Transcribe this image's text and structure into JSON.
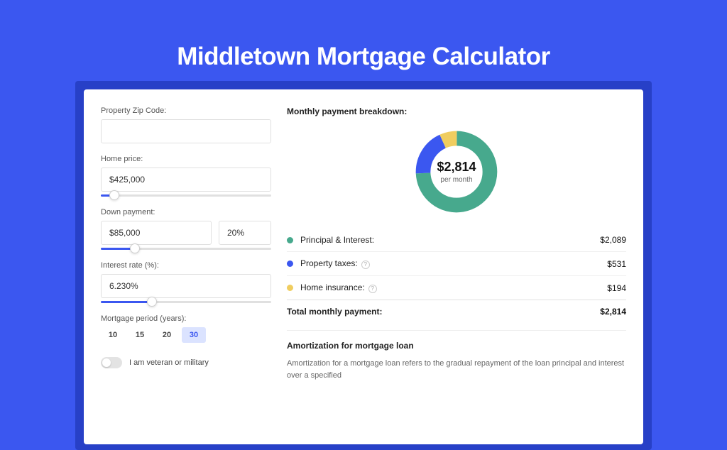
{
  "title": "Middletown Mortgage Calculator",
  "form": {
    "zip_label": "Property Zip Code:",
    "zip_value": "",
    "price_label": "Home price:",
    "price_value": "$425,000",
    "price_slider_pct": 8,
    "down_label": "Down payment:",
    "down_value": "$85,000",
    "down_pct_value": "20%",
    "down_slider_pct": 20,
    "rate_label": "Interest rate (%):",
    "rate_value": "6.230%",
    "rate_slider_pct": 30,
    "period_label": "Mortgage period (years):",
    "period_options": [
      {
        "label": "10",
        "active": false
      },
      {
        "label": "15",
        "active": false
      },
      {
        "label": "20",
        "active": false
      },
      {
        "label": "30",
        "active": true
      }
    ],
    "veteran_label": "I am veteran or military"
  },
  "breakdown": {
    "heading": "Monthly payment breakdown:",
    "center_amount": "$2,814",
    "center_sub": "per month",
    "items": [
      {
        "label": "Principal & Interest:",
        "value": "$2,089",
        "color": "#47a98d",
        "has_info": false
      },
      {
        "label": "Property taxes:",
        "value": "$531",
        "color": "#3b57f0",
        "has_info": true
      },
      {
        "label": "Home insurance:",
        "value": "$194",
        "color": "#f0cd5f",
        "has_info": true
      }
    ],
    "total_label": "Total monthly payment:",
    "total_value": "$2,814"
  },
  "amort": {
    "heading": "Amortization for mortgage loan",
    "body": "Amortization for a mortgage loan refers to the gradual repayment of the loan principal and interest over a specified"
  },
  "chart_data": {
    "type": "pie",
    "title": "Monthly payment breakdown",
    "series": [
      {
        "name": "Principal & Interest",
        "value": 2089,
        "color": "#47a98d"
      },
      {
        "name": "Property taxes",
        "value": 531,
        "color": "#3b57f0"
      },
      {
        "name": "Home insurance",
        "value": 194,
        "color": "#f0cd5f"
      }
    ],
    "total": 2814,
    "center_label": "$2,814 per month"
  }
}
